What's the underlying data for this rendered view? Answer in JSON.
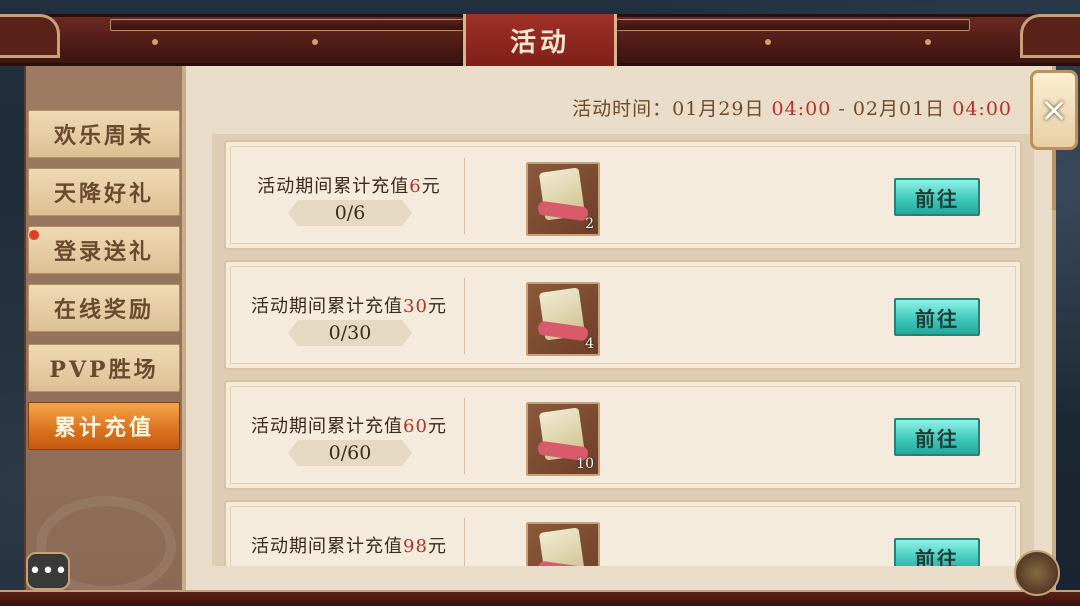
{
  "header": {
    "title": "活动"
  },
  "activity_time": {
    "label": "活动时间：",
    "start_date": "01月29日",
    "start_time": "04:00",
    "separator": "-",
    "end_date": "02月01日",
    "end_time": "04:00"
  },
  "sidebar": {
    "tabs": [
      {
        "label": "欢乐周末",
        "active": false,
        "badge": false
      },
      {
        "label": "天降好礼",
        "active": false,
        "badge": false
      },
      {
        "label": "登录送礼",
        "active": false,
        "badge": true
      },
      {
        "label": "在线奖励",
        "active": false,
        "badge": false
      },
      {
        "label": "PVP胜场",
        "active": false,
        "badge": false
      },
      {
        "label": "累计充值",
        "active": true,
        "badge": false
      }
    ]
  },
  "rewards": [
    {
      "task_prefix": "活动期间累计充值",
      "amount": "6",
      "unit": "元",
      "progress": "0/6",
      "item_qty": "2",
      "button": "前往"
    },
    {
      "task_prefix": "活动期间累计充值",
      "amount": "30",
      "unit": "元",
      "progress": "0/30",
      "item_qty": "4",
      "button": "前往"
    },
    {
      "task_prefix": "活动期间累计充值",
      "amount": "60",
      "unit": "元",
      "progress": "0/60",
      "item_qty": "10",
      "button": "前往"
    },
    {
      "task_prefix": "活动期间累计充值",
      "amount": "98",
      "unit": "元",
      "progress": "",
      "item_qty": "",
      "button": "前往"
    }
  ],
  "controls": {
    "close_icon": "×",
    "chat_icon": "•••"
  },
  "colors": {
    "accent_red": "#b4322a",
    "go_button": "#3fc9bb",
    "active_tab": "#d9711e"
  }
}
